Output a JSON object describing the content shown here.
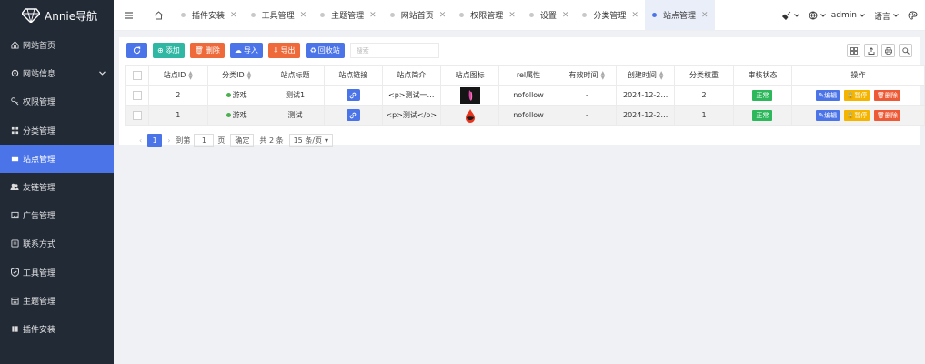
{
  "brand": {
    "name": "Annie导航"
  },
  "sidebar": {
    "items": [
      {
        "label": "网站首页",
        "icon": "home-icon"
      },
      {
        "label": "网站信息",
        "icon": "gear-icon",
        "has_children": true
      },
      {
        "label": "权限管理",
        "icon": "key-icon"
      },
      {
        "label": "分类管理",
        "icon": "sitemap-icon"
      },
      {
        "label": "站点管理",
        "icon": "window-icon",
        "active": true
      },
      {
        "label": "友链管理",
        "icon": "users-icon"
      },
      {
        "label": "广告管理",
        "icon": "image-icon"
      },
      {
        "label": "联系方式",
        "icon": "phone-icon"
      },
      {
        "label": "工具管理",
        "icon": "shield-icon"
      },
      {
        "label": "主题管理",
        "icon": "calendar-icon"
      },
      {
        "label": "插件安装",
        "icon": "puzzle-icon"
      }
    ]
  },
  "topbar": {
    "tabs": [
      {
        "label": "插件安装"
      },
      {
        "label": "工具管理"
      },
      {
        "label": "主题管理"
      },
      {
        "label": "网站首页"
      },
      {
        "label": "权限管理"
      },
      {
        "label": "设置"
      },
      {
        "label": "分类管理"
      },
      {
        "label": "站点管理",
        "active": true
      }
    ],
    "user": "admin",
    "language": "语言"
  },
  "toolbar": {
    "add": "添加",
    "delete": "删除",
    "import": "导入",
    "export": "导出",
    "recycle": "回收站",
    "search_placeholder": "搜索"
  },
  "table": {
    "headers": [
      "站点ID",
      "分类ID",
      "站点标题",
      "站点链接",
      "站点简介",
      "站点图标",
      "rel属性",
      "有效时间",
      "创建时间",
      "分类权重",
      "审核状态",
      "操作"
    ],
    "rows": [
      {
        "id": "2",
        "category": "游戏",
        "title": "测试1",
        "intro": "<p>测试一…",
        "rel": "nofollow",
        "valid": "-",
        "created": "2024-12-2…",
        "weight": "2",
        "status": "正常"
      },
      {
        "id": "1",
        "category": "游戏",
        "title": "测试",
        "intro": "<p>测试</p>",
        "rel": "nofollow",
        "valid": "-",
        "created": "2024-12-2…",
        "weight": "1",
        "status": "正常"
      }
    ],
    "actions": {
      "edit": "编辑",
      "suspend": "暂停",
      "delete": "删除"
    }
  },
  "pager": {
    "current": "1",
    "goto_label": "到第",
    "page_input": "1",
    "page_unit": "页",
    "confirm": "确定",
    "total": "共 2 条",
    "page_size": "15 条/页"
  },
  "colors": {
    "sidebar_bg": "#222a36",
    "accent": "#4b74e8",
    "add": "#2fb7a4",
    "danger": "#ee6a3a",
    "success": "#2eb85c",
    "warning": "#f5b400"
  }
}
